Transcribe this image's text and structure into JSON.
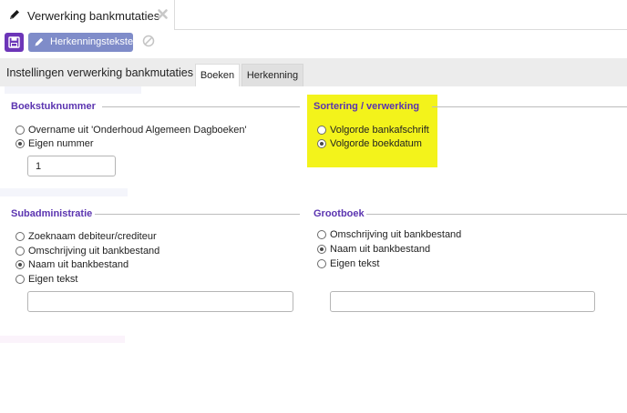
{
  "window_tab": {
    "title": "Verwerking bankmutaties"
  },
  "toolbar": {
    "herkenning_label": "Herkenningsteksten"
  },
  "band": {
    "title": "Instellingen verwerking bankmutaties",
    "tabs": [
      {
        "label": "Boeken",
        "active": true
      },
      {
        "label": "Herkenning",
        "active": false
      }
    ]
  },
  "boekstuknummer": {
    "label": "Boekstuknummer",
    "options": [
      {
        "label": "Overname uit 'Onderhoud Algemeen Dagboeken'",
        "checked": false
      },
      {
        "label": "Eigen nummer",
        "checked": true
      }
    ],
    "value": "1"
  },
  "sortering": {
    "label": "Sortering / verwerking",
    "highlight_color": "#f3f31b",
    "options": [
      {
        "label": "Volgorde bankafschrift",
        "checked": false
      },
      {
        "label": "Volgorde boekdatum",
        "checked": true
      }
    ]
  },
  "subadministratie": {
    "label": "Subadministratie",
    "options": [
      {
        "label": "Zoeknaam debiteur/crediteur",
        "checked": false
      },
      {
        "label": "Omschrijving uit bankbestand",
        "checked": false
      },
      {
        "label": "Naam uit bankbestand",
        "checked": true
      },
      {
        "label": "Eigen tekst",
        "checked": false
      }
    ],
    "value": ""
  },
  "grootboek": {
    "label": "Grootboek",
    "options": [
      {
        "label": "Omschrijving uit bankbestand",
        "checked": false
      },
      {
        "label": "Naam uit bankbestand",
        "checked": true
      },
      {
        "label": "Eigen tekst",
        "checked": false
      }
    ],
    "value": ""
  },
  "colors": {
    "accent": "#5b34b0",
    "save_button": "#6c35b8",
    "secondary_button": "#7f8cc9"
  }
}
